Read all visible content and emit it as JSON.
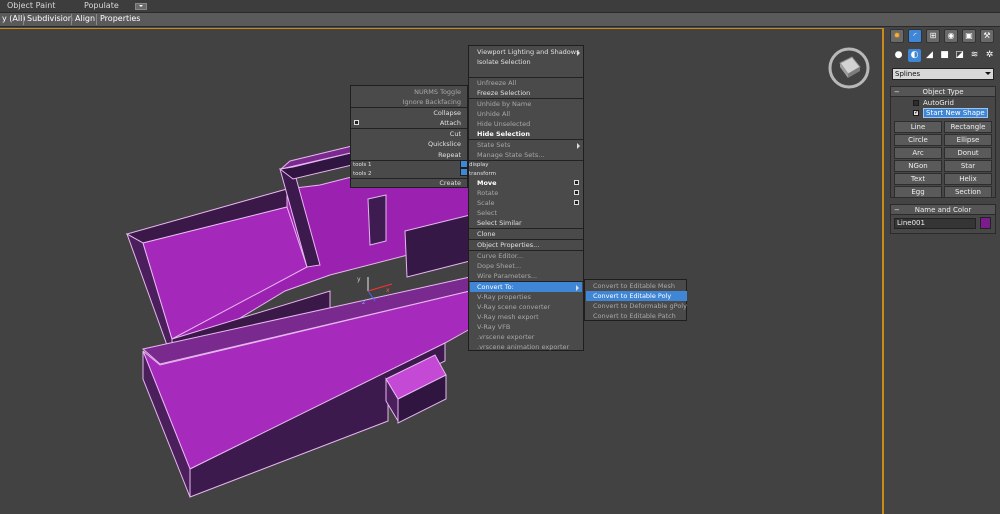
{
  "ribbon": {
    "top_tabs": [
      "Object Paint",
      "Populate"
    ],
    "sub_tabs": [
      "y (All)",
      "Subdivision",
      "Align",
      "Properties"
    ]
  },
  "command_panel": {
    "tab_icons": [
      "create-icon",
      "modify-icon",
      "hierarchy-icon",
      "motion-icon",
      "display-icon",
      "utilities-icon"
    ],
    "category_icons": [
      "geometry-icon",
      "shapes-icon",
      "lights-icon",
      "cameras-icon",
      "helpers-icon",
      "spacewarps-icon",
      "systems-icon"
    ],
    "dropdown_value": "Splines",
    "object_type": {
      "title": "Object Type",
      "autogrid": "AutoGrid",
      "start_new_shape": "Start New Shape",
      "buttons": [
        "Line",
        "Rectangle",
        "Circle",
        "Ellipse",
        "Arc",
        "Donut",
        "NGon",
        "Star",
        "Text",
        "Helix",
        "Egg",
        "Section"
      ]
    },
    "name_and_color": {
      "title": "Name and Color",
      "name_value": "Line001",
      "color": "#7a1c8c"
    }
  },
  "quad_left": {
    "items": [
      {
        "label": "NURMS Toggle",
        "style": "dim"
      },
      {
        "label": "Ignore Backfacing",
        "style": "dim"
      },
      {
        "label": "Collapse",
        "style": "normal"
      },
      {
        "label": "Attach",
        "style": "normal"
      },
      {
        "label": "Cut",
        "style": "normal"
      },
      {
        "label": "Quickslice",
        "style": "normal"
      },
      {
        "label": "Repeat",
        "style": "normal"
      }
    ],
    "quad_labels": {
      "tools1": "tools 1",
      "tools2": "tools 2",
      "display": "display",
      "transform": "transform"
    },
    "create": "Create"
  },
  "quad_right": {
    "items": [
      {
        "label": "Viewport Lighting and Shadows",
        "style": "normal",
        "submenu": true
      },
      {
        "label": "Isolate Selection",
        "style": "normal"
      },
      {
        "label": "Unfreeze All",
        "style": "dim"
      },
      {
        "label": "Freeze Selection",
        "style": "normal"
      },
      {
        "label": "Unhide by Name",
        "style": "dim"
      },
      {
        "label": "Unhide All",
        "style": "dim"
      },
      {
        "label": "Hide Unselected",
        "style": "dim"
      },
      {
        "label": "Hide Selection",
        "style": "bold"
      },
      {
        "label": "State Sets",
        "style": "dim",
        "submenu": true
      },
      {
        "label": "Manage State Sets...",
        "style": "dim"
      },
      {
        "label": "Move",
        "style": "bold"
      },
      {
        "label": "Rotate",
        "style": "dim"
      },
      {
        "label": "Scale",
        "style": "dim"
      },
      {
        "label": "Select",
        "style": "dim"
      },
      {
        "label": "Select Similar",
        "style": "normal"
      },
      {
        "label": "Clone",
        "style": "normal"
      },
      {
        "label": "Object Properties...",
        "style": "normal"
      },
      {
        "label": "Curve Editor...",
        "style": "dim"
      },
      {
        "label": "Dope Sheet...",
        "style": "dim"
      },
      {
        "label": "Wire Parameters...",
        "style": "dim"
      },
      {
        "label": "Convert To:",
        "style": "sel",
        "submenu": true
      },
      {
        "label": "V-Ray properties",
        "style": "dim"
      },
      {
        "label": "V-Ray scene converter",
        "style": "dim"
      },
      {
        "label": "V-Ray mesh export",
        "style": "dim"
      },
      {
        "label": "V-Ray VFB",
        "style": "dim"
      },
      {
        "label": ".vrscene exporter",
        "style": "dim"
      },
      {
        "label": ".vrscene animation exporter",
        "style": "dim"
      }
    ]
  },
  "convert_submenu": {
    "items": [
      {
        "label": "Convert to Editable Mesh",
        "selected": false
      },
      {
        "label": "Convert to Editable Poly",
        "selected": true
      },
      {
        "label": "Convert to Deformable gPoly",
        "selected": false
      },
      {
        "label": "Convert to Editable Patch",
        "selected": false
      }
    ]
  },
  "gizmo": {
    "x": "x",
    "y": "y",
    "z": "z"
  }
}
